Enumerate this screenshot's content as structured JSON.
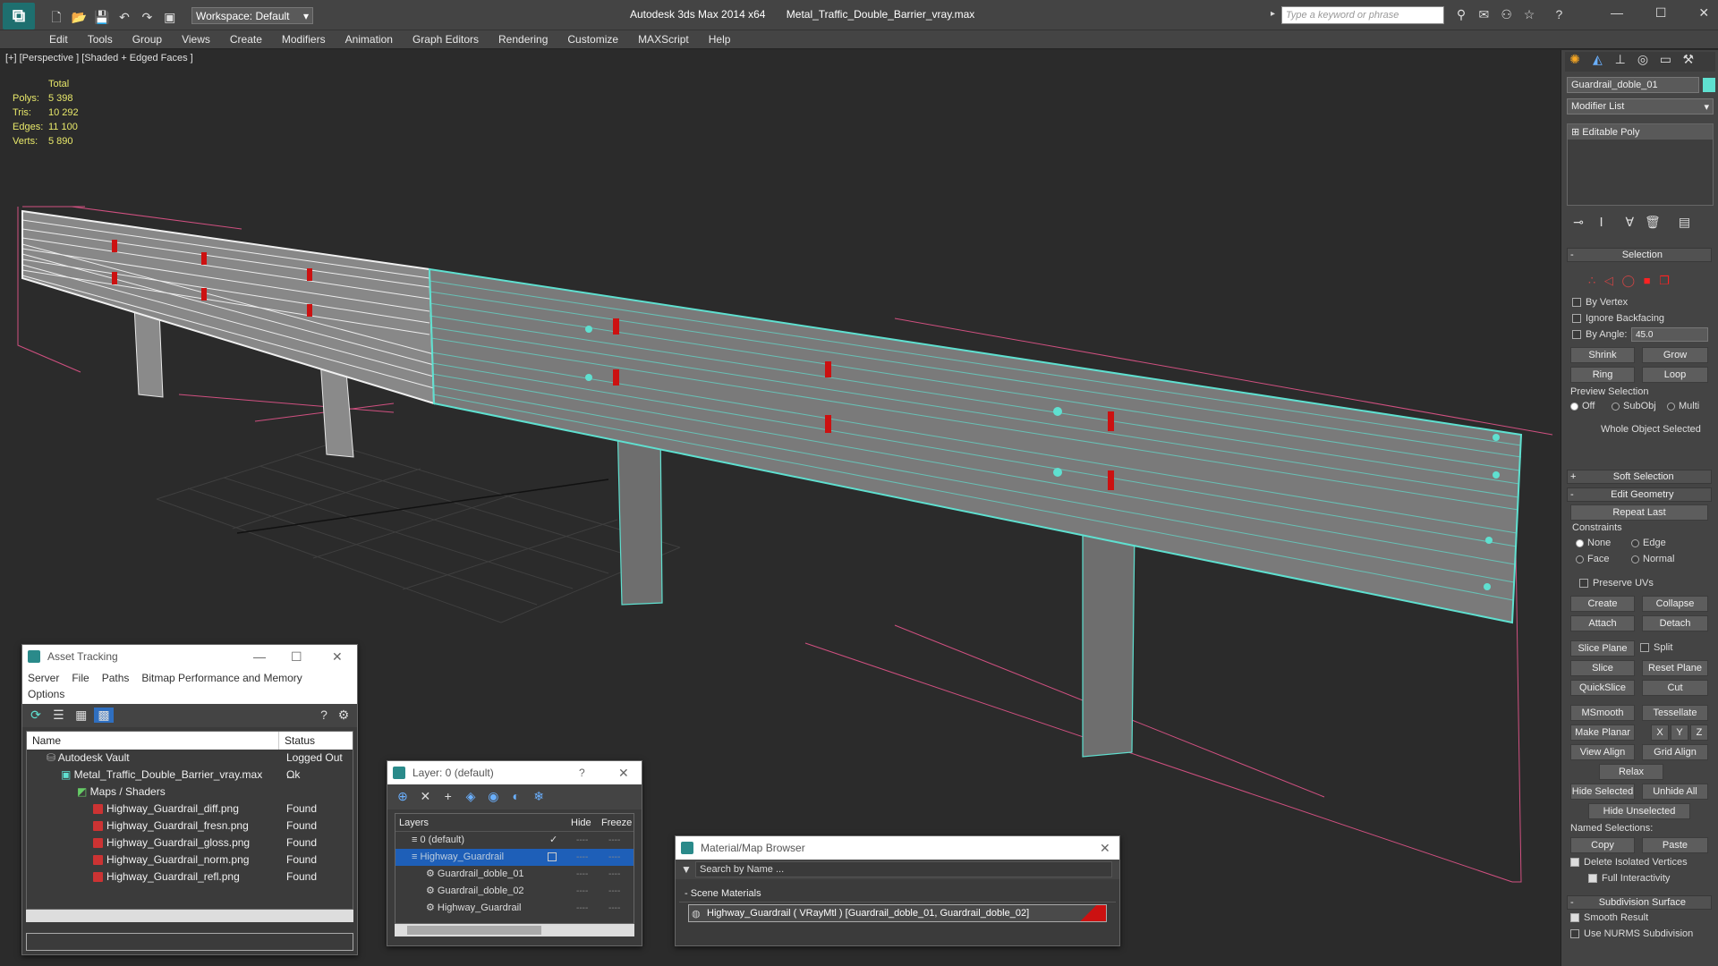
{
  "app": {
    "title": "Autodesk 3ds Max  2014 x64",
    "filename": "Metal_Traffic_Double_Barrier_vray.max",
    "workspace": "Workspace: Default",
    "search_placeholder": "Type a keyword or phrase"
  },
  "menu": [
    "Edit",
    "Tools",
    "Group",
    "Views",
    "Create",
    "Modifiers",
    "Animation",
    "Graph Editors",
    "Rendering",
    "Customize",
    "MAXScript",
    "Help"
  ],
  "viewport": {
    "label": "[+] [Perspective ] [Shaded + Edged Faces ]",
    "stats_header": "Total",
    "stats": [
      {
        "label": "Polys:",
        "value": "5 398"
      },
      {
        "label": "Tris:",
        "value": "10 292"
      },
      {
        "label": "Edges:",
        "value": "11 100"
      },
      {
        "label": "Verts:",
        "value": "5 890"
      }
    ]
  },
  "command_panel": {
    "object_name": "Guardrail_doble_01",
    "modifier_list": "Modifier List",
    "stack_item": "Editable Poly",
    "selection": {
      "title": "Selection",
      "by_vertex": "By Vertex",
      "ignore_backfacing": "Ignore Backfacing",
      "by_angle": "By Angle:",
      "angle_value": "45.0",
      "shrink": "Shrink",
      "grow": "Grow",
      "ring": "Ring",
      "loop": "Loop",
      "preview_selection": "Preview Selection",
      "off": "Off",
      "subobj": "SubObj",
      "multi": "Multi",
      "status": "Whole Object Selected"
    },
    "soft_selection": "Soft Selection",
    "edit_geometry": {
      "title": "Edit Geometry",
      "repeat_last": "Repeat Last",
      "constraints": "Constraints",
      "none": "None",
      "edge": "Edge",
      "face": "Face",
      "normal": "Normal",
      "preserve_uvs": "Preserve UVs",
      "create": "Create",
      "collapse": "Collapse",
      "attach": "Attach",
      "detach": "Detach",
      "slice_plane": "Slice Plane",
      "split": "Split",
      "slice": "Slice",
      "reset_plane": "Reset Plane",
      "quickslice": "QuickSlice",
      "cut": "Cut",
      "msmooth": "MSmooth",
      "tessellate": "Tessellate",
      "make_planar": "Make Planar",
      "x": "X",
      "y": "Y",
      "z": "Z",
      "view_align": "View Align",
      "grid_align": "Grid Align",
      "relax": "Relax",
      "hide_selected": "Hide Selected",
      "unhide_all": "Unhide All",
      "hide_unselected": "Hide Unselected",
      "named_selections": "Named Selections:",
      "copy": "Copy",
      "paste": "Paste",
      "delete_isolated": "Delete Isolated Vertices",
      "full_interactivity": "Full Interactivity"
    },
    "subdivision": {
      "title": "Subdivision Surface",
      "smooth_result": "Smooth Result",
      "use_nurms": "Use NURMS Subdivision"
    }
  },
  "asset_tracking": {
    "title": "Asset Tracking",
    "menu": [
      "Server",
      "File",
      "Paths",
      "Bitmap Performance and Memory"
    ],
    "menu2": "Options",
    "col_name": "Name",
    "col_status": "Status",
    "rows": [
      {
        "name": "Autodesk Vault",
        "status": "Logged Out ..."
      },
      {
        "name": "Metal_Traffic_Double_Barrier_vray.max",
        "status": "Ok"
      },
      {
        "name": "Maps / Shaders",
        "status": ""
      },
      {
        "name": "Highway_Guardrail_diff.png",
        "status": "Found"
      },
      {
        "name": "Highway_Guardrail_fresn.png",
        "status": "Found"
      },
      {
        "name": "Highway_Guardrail_gloss.png",
        "status": "Found"
      },
      {
        "name": "Highway_Guardrail_norm.png",
        "status": "Found"
      },
      {
        "name": "Highway_Guardrail_refl.png",
        "status": "Found"
      }
    ]
  },
  "layer_window": {
    "title": "Layer: 0 (default)",
    "help": "?",
    "col_layers": "Layers",
    "col_hide": "Hide",
    "col_freeze": "Freeze",
    "rows": [
      "0 (default)",
      "Highway_Guardrail",
      "Guardrail_doble_01",
      "Guardrail_doble_02",
      "Highway_Guardrail"
    ]
  },
  "material_browser": {
    "title": "Material/Map Browser",
    "search": "Search by Name ...",
    "group": "- Scene Materials",
    "item": "Highway_Guardrail  ( VRayMtl )  [Guardrail_doble_01, Guardrail_doble_02]"
  },
  "colors": {
    "selection_cyan": "#5fe0d0",
    "accent_red": "#cc1111",
    "highlight_blue": "#1e5fb8"
  }
}
